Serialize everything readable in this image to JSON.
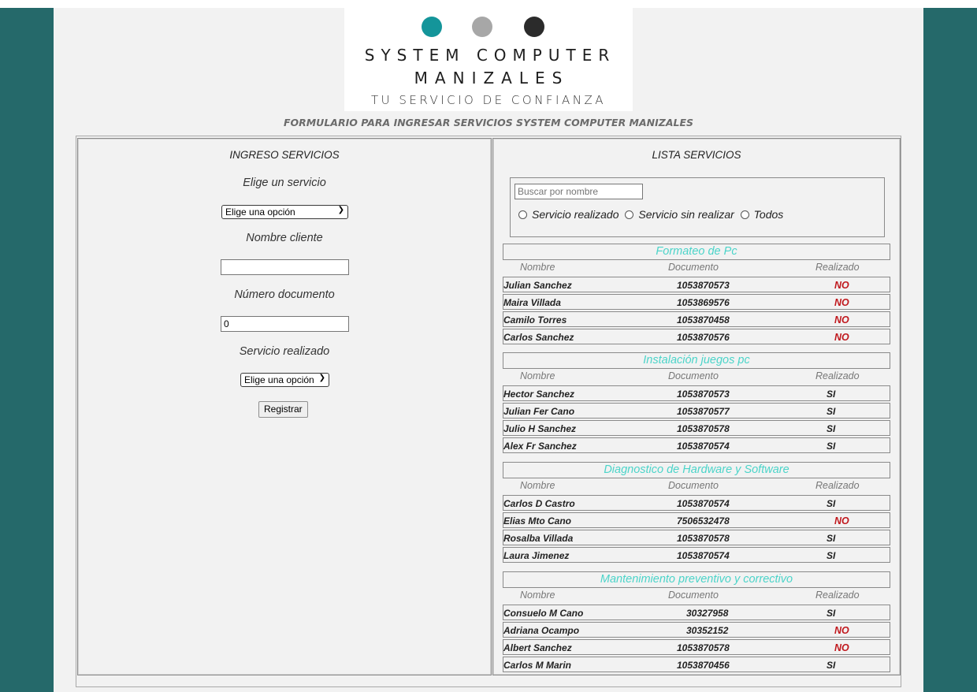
{
  "logo": {
    "line1": "SYSTEM COMPUTER",
    "line2": "MANIZALES",
    "line3": "TU SERVICIO DE CONFIANZA",
    "dot_colors": [
      "#14959a",
      "#a7a7a7",
      "#2b2b2b"
    ]
  },
  "form_title": "FORMULARIO PARA INGRESAR SERVICIOS SYSTEM COMPUTER MANIZALES",
  "ingreso": {
    "heading": "INGRESO SERVICIOS",
    "servicio_label": "Elige un servicio",
    "servicio_value": "Elige una opción",
    "nombre_label": "Nombre cliente",
    "nombre_value": "",
    "documento_label": "Número documento",
    "documento_value": "0",
    "realizado_label": "Servicio realizado",
    "realizado_value": "Elige una opción",
    "submit_label": "Registrar"
  },
  "lista": {
    "heading": "LISTA SERVICIOS",
    "search_placeholder": "Buscar por nombre",
    "filters": [
      "Servicio realizado",
      "Servicio sin realizar",
      "Todos"
    ],
    "columns": [
      "Nombre",
      "Documento",
      "Realizado"
    ],
    "groups": [
      {
        "title": "Formateo de Pc",
        "rows": [
          {
            "nombre": "Julian Sanchez",
            "documento": "1053870573",
            "realizado": "NO"
          },
          {
            "nombre": "Maira Villada",
            "documento": "1053869576",
            "realizado": "NO"
          },
          {
            "nombre": "Camilo Torres",
            "documento": "1053870458",
            "realizado": "NO"
          },
          {
            "nombre": "Carlos Sanchez",
            "documento": "1053870576",
            "realizado": "NO"
          }
        ]
      },
      {
        "title": "Instalación juegos pc",
        "rows": [
          {
            "nombre": "Hector Sanchez",
            "documento": "1053870573",
            "realizado": "SI"
          },
          {
            "nombre": "Julian Fer Cano",
            "documento": "1053870577",
            "realizado": "SI"
          },
          {
            "nombre": "Julio H Sanchez",
            "documento": "1053870578",
            "realizado": "SI"
          },
          {
            "nombre": "Alex Fr Sanchez",
            "documento": "1053870574",
            "realizado": "SI"
          }
        ]
      },
      {
        "title": "Diagnostico de Hardware y Software",
        "rows": [
          {
            "nombre": "Carlos D Castro",
            "documento": "1053870574",
            "realizado": "SI"
          },
          {
            "nombre": "Elias Mto Cano",
            "documento": "7506532478",
            "realizado": "NO"
          },
          {
            "nombre": "Rosalba Villada",
            "documento": "1053870578",
            "realizado": "SI"
          },
          {
            "nombre": "Laura Jimenez",
            "documento": "1053870574",
            "realizado": "SI"
          }
        ]
      },
      {
        "title": "Mantenimiento preventivo y correctivo",
        "rows": [
          {
            "nombre": "Consuelo M Cano",
            "documento": "30327958",
            "realizado": "SI"
          },
          {
            "nombre": "Adriana Ocampo",
            "documento": "30352152",
            "realizado": "NO"
          },
          {
            "nombre": "Albert Sanchez",
            "documento": "1053870578",
            "realizado": "NO"
          },
          {
            "nombre": "Carlos M Marin",
            "documento": "1053870456",
            "realizado": "SI"
          }
        ]
      }
    ]
  },
  "colors": {
    "side_bars": "#25696a",
    "group_title": "#4bd4c9",
    "no_status": "#c0181d"
  }
}
